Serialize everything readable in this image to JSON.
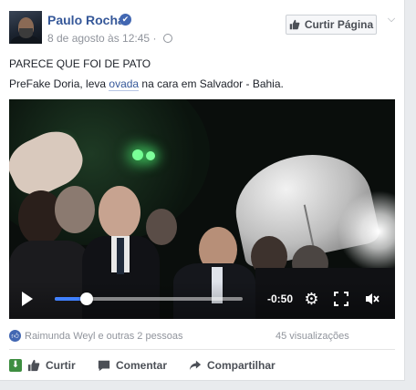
{
  "post": {
    "author": "Paulo Rocha",
    "timestamp": "8 de agosto às 12:45",
    "separator": "·",
    "like_page_label": "Curtir Página",
    "text_line1": "PARECE QUE FOI DE PATO",
    "text_line2_before": "PreFake Doria, leva ",
    "text_line2_link": "ovada",
    "text_line2_after": " na cara em Salvador - Bahia."
  },
  "video": {
    "time_remaining": "-0:50",
    "progress_fraction": 0.17
  },
  "stats": {
    "reactors": "Raimunda Weyl e outras 2 pessoas",
    "views": "45 visualizações"
  },
  "actions": {
    "like": "Curtir",
    "comment": "Comentar",
    "share": "Compartilhar"
  },
  "icons": {
    "verified": "verified-badge-icon",
    "globe": "globe-icon",
    "chevron": "chevron-down-icon",
    "play": "play-icon",
    "gear": "gear-icon",
    "fullscreen": "fullscreen-icon",
    "mute": "mute-icon",
    "like": "thumbs-up-icon",
    "comment": "comment-icon",
    "share": "share-icon"
  },
  "colors": {
    "link": "#365899",
    "accent": "#4267b2",
    "progress": "#4080ff",
    "meta": "#90949c"
  }
}
